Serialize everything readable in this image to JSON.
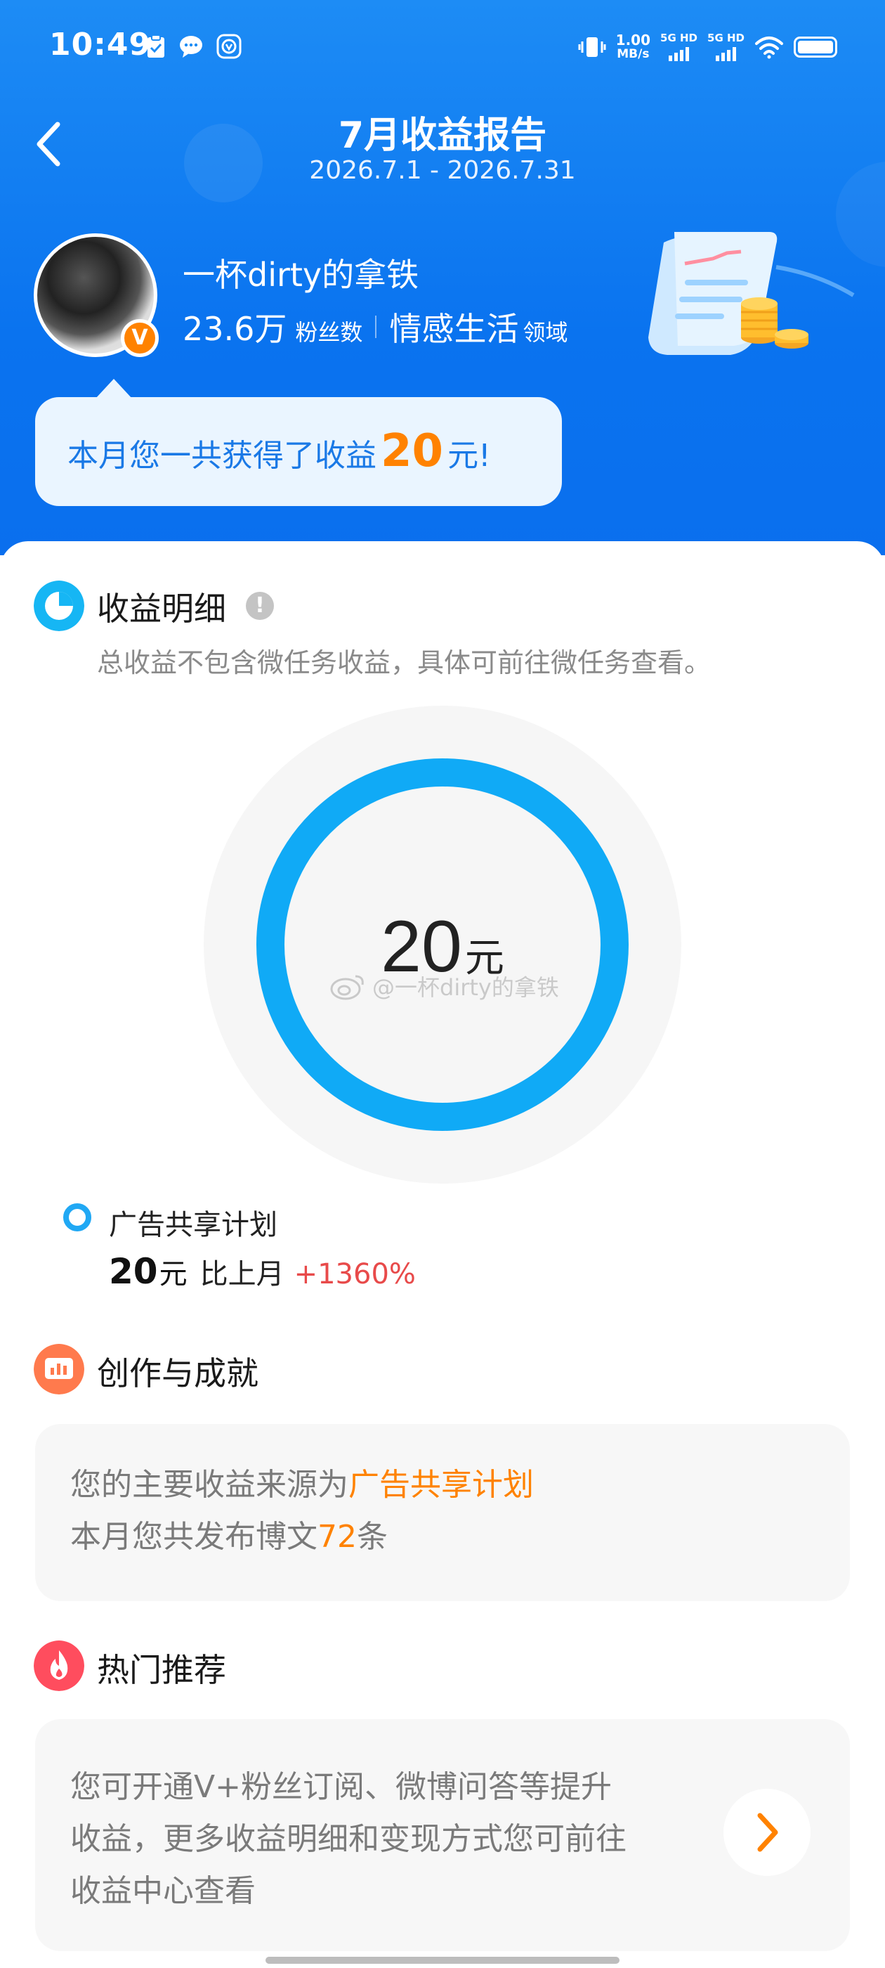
{
  "status_bar": {
    "time": "10:49",
    "net_speed_value": "1.00",
    "net_speed_unit": "MB/s",
    "sim1": "5G HD",
    "sim2": "5G HD"
  },
  "header": {
    "title": "7月收益报告",
    "period": "2026.7.1 - 2026.7.31"
  },
  "profile": {
    "username": "一杯dirty的拿铁",
    "fans_count": "23.6万",
    "fans_label": "粉丝数",
    "domain_name": "情感生活",
    "domain_label": "领域",
    "verified_badge": "V"
  },
  "bubble": {
    "prefix": "本月您一共获得了收益",
    "amount": "20",
    "suffix": "元!"
  },
  "income_detail": {
    "title": "收益明细",
    "info_icon": "!",
    "subtitle": "总收益不包含微任务收益，具体可前往微任务查看。",
    "total_value": "20",
    "total_unit": "元",
    "watermark": "@一杯dirty的拿铁",
    "ring_color": "#10aaf6",
    "ring_fraction": 1.0
  },
  "legend": {
    "name": "广告共享计划",
    "value": "20",
    "unit": "元",
    "compare_label": "比上月",
    "change": "+1360%"
  },
  "creation": {
    "title": "创作与成就",
    "line1_prefix": "您的主要收益来源为",
    "line1_highlight": "广告共享计划",
    "line2_prefix": "本月您共发布博文",
    "line2_count": "72",
    "line2_suffix": "条"
  },
  "hot": {
    "title": "热门推荐",
    "lines": [
      "您可开通V+粉丝订阅、微博问答等提升",
      "收益，更多收益明细和变现方式您可前往",
      "收益中心查看"
    ]
  },
  "colors": {
    "header_blue": "#0a73ef",
    "accent_orange": "#ff8200",
    "ring_blue": "#10aaf6",
    "increase_red": "#e84a4a"
  },
  "icons": {
    "back": "chevron-left-icon",
    "income": "pie-chart-icon",
    "creation": "bar-chart-icon",
    "hot": "flame-icon",
    "more": "chevron-right-icon"
  }
}
